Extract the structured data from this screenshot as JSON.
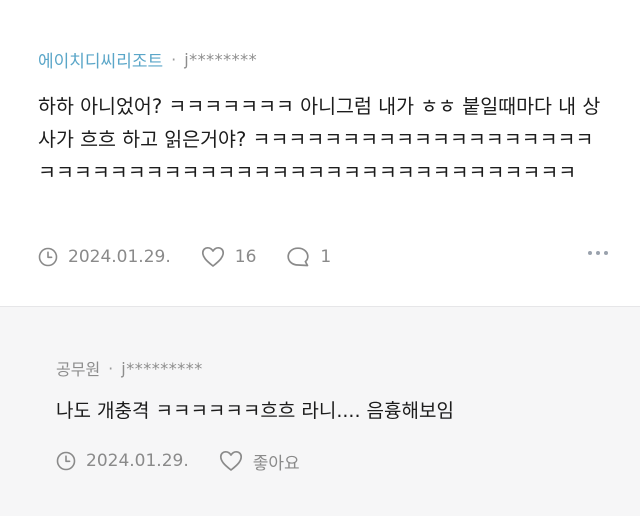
{
  "comment": {
    "company": "에이치디씨리조트",
    "separator": "·",
    "user": "j********",
    "body": "하하 아니었어? ㅋㅋㅋㅋㅋㅋㅋ 아니그럼 내가 ㅎㅎ 붙일때마다 내 상사가 흐흐 하고 읽은거야? ㅋㅋㅋㅋㅋㅋㅋㅋㅋㅋㅋㅋㅋㅋㅋㅋㅋㅋㅋㅋㅋㅋㅋㅋㅋㅋㅋㅋㅋㅋㅋㅋㅋㅋㅋㅋㅋㅋㅋㅋㅋㅋㅋㅋㅋㅋㅋㅋㅋ",
    "date": "2024.01.29.",
    "likes": "16",
    "replies": "1",
    "icons": [
      "clock-icon",
      "heart-icon",
      "speech-bubble-icon",
      "more-options-icon"
    ]
  },
  "reply": {
    "company": "공무원",
    "separator": "·",
    "user": "j*********",
    "body": "나도 개충격 ㅋㅋㅋㅋㅋㅋ흐흐 라니.... 음흉해보임",
    "date": "2024.01.29.",
    "like_label": "좋아요",
    "icons": [
      "clock-icon",
      "heart-icon"
    ]
  },
  "colors": {
    "company_link": "#5aa6c8",
    "reply_background": "#f6f6f7",
    "muted_text": "#8a8a8a"
  }
}
